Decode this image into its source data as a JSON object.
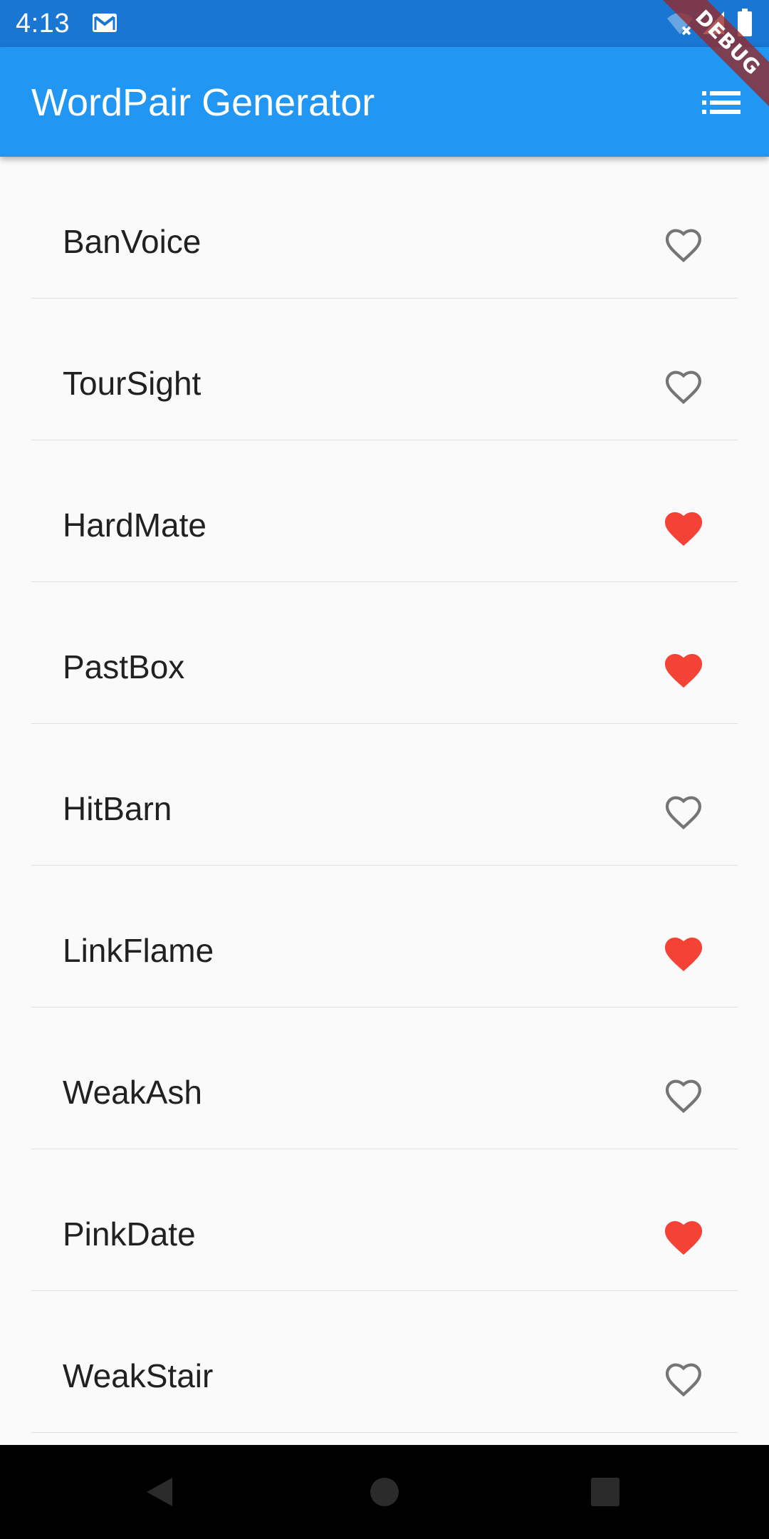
{
  "status_bar": {
    "time": "4:13",
    "icons": [
      "gmail-icon",
      "wifi-off-icon",
      "signal-icon",
      "battery-icon"
    ]
  },
  "debug_banner": {
    "label": "DEBUG"
  },
  "app_bar": {
    "title": "WordPair Generator",
    "action_icon": "list-icon"
  },
  "word_pairs": [
    {
      "label": "BanVoice",
      "saved": false
    },
    {
      "label": "TourSight",
      "saved": false
    },
    {
      "label": "HardMate",
      "saved": true
    },
    {
      "label": "PastBox",
      "saved": true
    },
    {
      "label": "HitBarn",
      "saved": false
    },
    {
      "label": "LinkFlame",
      "saved": true
    },
    {
      "label": "WeakAsh",
      "saved": false
    },
    {
      "label": "PinkDate",
      "saved": true
    },
    {
      "label": "WeakStair",
      "saved": false
    }
  ],
  "colors": {
    "status_bar": "#1976d2",
    "app_bar": "#2196f3",
    "saved_heart": "#f44336",
    "unsaved_heart": "#757575",
    "background": "#fafafa"
  },
  "nav_bar": {
    "buttons": [
      "back-icon",
      "home-icon",
      "recents-icon"
    ]
  }
}
